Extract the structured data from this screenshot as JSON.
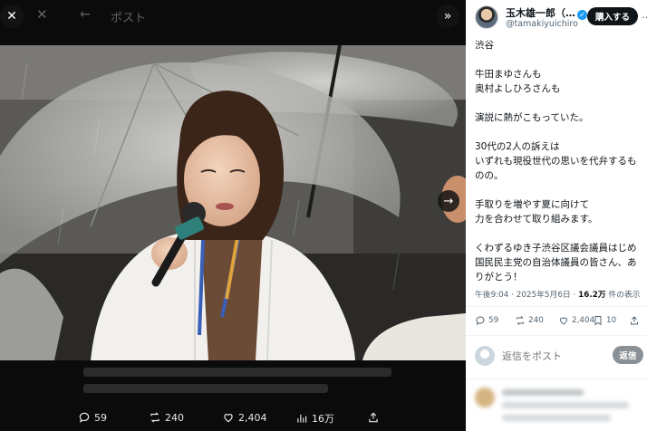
{
  "viewer": {
    "header_title": "ポスト",
    "close_icon": "close-icon",
    "collapse_icon": "double-chevron-right-icon",
    "next_icon": "arrow-right-icon",
    "photo_alt": "雨の中、傘の下でマイクを持って演説する白いレインコートの女性",
    "actions": {
      "replies": "59",
      "reposts": "240",
      "likes": "2,404",
      "views": "16万"
    }
  },
  "panel": {
    "author": {
      "name": "玉木雄一郎（…",
      "handle": "@tamakiyuichiro",
      "subscribe_label": "購入する",
      "verified": true
    },
    "tweet": {
      "lines": [
        "渋谷",
        "牛田まゆさんも\n奥村よしひろさんも",
        "演説に熱がこもっていた。",
        "30代の2人の訴えは\nいずれも現役世代の思いを代弁するものの。",
        "手取りを増やす夏に向けて\n力を合わせて取り組みます。",
        "くわずるゆき子渋谷区議会議員はじめ\n国民民主党の自治体議員の皆さん、ありがとう！"
      ]
    },
    "meta": {
      "time": "午後9:04 · 2025年5月6日 · ",
      "views_count": "16.2万",
      "views_label": " 件の表示"
    },
    "stats": {
      "replies": "59",
      "reposts": "240",
      "likes": "2,404",
      "bookmarks": "10"
    },
    "reply": {
      "placeholder": "返信をポスト",
      "button_label": "返信"
    }
  },
  "colors": {
    "accent": "#1d9bf0",
    "text": "#0f1419",
    "muted": "#536471"
  }
}
